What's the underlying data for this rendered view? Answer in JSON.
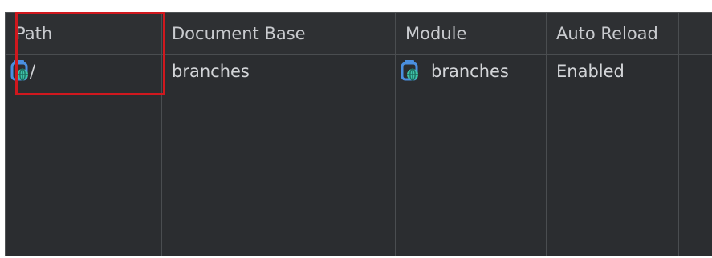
{
  "table": {
    "headers": [
      "Path",
      "Document Base",
      "Module",
      "Auto Reload"
    ],
    "rows": [
      {
        "path": "/",
        "document_base": "branches",
        "module": "branches",
        "auto_reload": "Enabled"
      }
    ]
  },
  "icons": {
    "path_icon": "web-module-icon",
    "module_icon": "web-module-icon"
  },
  "colors": {
    "highlight": "#d0181e",
    "background": "#2b2d30",
    "icon_blue": "#4a8fe0",
    "icon_globe": "#3ec2a8"
  }
}
